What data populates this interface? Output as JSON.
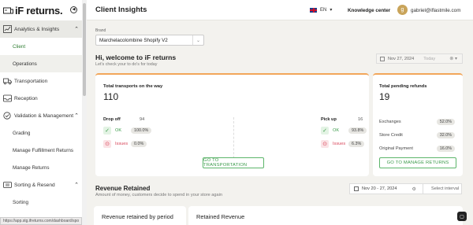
{
  "app": {
    "logo_text": "iF returns.",
    "page_title": "Client Insights"
  },
  "header": {
    "language": "EN",
    "knowledge_center": "Knowledge center",
    "avatar_letter": "g",
    "user_email": "gabriel@iflastmile.com"
  },
  "sidebar": {
    "sections": [
      {
        "label": "Analytics & Insights",
        "icon": "analytics-icon",
        "expanded": true
      },
      {
        "label": "Transportation",
        "icon": "truck-icon"
      },
      {
        "label": "Reception",
        "icon": "inbox-icon"
      },
      {
        "label": "Validation & Management",
        "icon": "check-circle-icon",
        "expanded": true
      },
      {
        "label": "Sorting & Resend",
        "icon": "sort-icon",
        "expanded": true
      }
    ],
    "analytics_items": [
      "Client",
      "Operations"
    ],
    "validation_items": [
      "Grading",
      "Manage Fulfillment Returns",
      "Manage Returns"
    ],
    "sorting_items": [
      "Sorting"
    ],
    "status_url": "https://app.stg.ifreturns.com/dashboard/spo"
  },
  "brand": {
    "label": "Brand",
    "value": "Marchelacolombine Shopify V2"
  },
  "welcome": {
    "title": "Hi, welcome to iF returns",
    "subtitle": "Let's check your to do's for today"
  },
  "date_filter": {
    "date": "Nov 27, 2024",
    "placeholder": "Today"
  },
  "transports": {
    "title": "Total transports on the way",
    "total": "110",
    "drop_off": {
      "label": "Drop off",
      "count": "94",
      "ok_label": "OK",
      "ok_pct": "100.0%",
      "issues_label": "Issues",
      "issues_pct": "0.0%"
    },
    "pick_up": {
      "label": "Pick up",
      "count": "16",
      "ok_label": "OK",
      "ok_pct": "93.8%",
      "issues_label": "Issues",
      "issues_pct": "6.3%"
    },
    "button": "GO TO TRANSPORTATION"
  },
  "refunds": {
    "title": "Total pending refunds",
    "total": "19",
    "rows": [
      {
        "label": "Exchanges",
        "value": "52.0%"
      },
      {
        "label": "Store Credit",
        "value": "32.0%"
      },
      {
        "label": "Original Payment",
        "value": "16.0%"
      }
    ],
    "button": "GO TO MANAGE RETURNS"
  },
  "revenue": {
    "title": "Revenue Retained",
    "subtitle": "Amount of money, customers decide to spend in your store again",
    "date_range": "Nov 20 - 27, 2024",
    "select_interval": "Select interval",
    "card_by_period": "Revenue retained by period",
    "card_retained": "Retained Revenue"
  },
  "colors": {
    "accent": "#f2a65a",
    "ok": "#3b9a4a",
    "issue": "#d9475b",
    "active_nav": "#2e7d32"
  }
}
